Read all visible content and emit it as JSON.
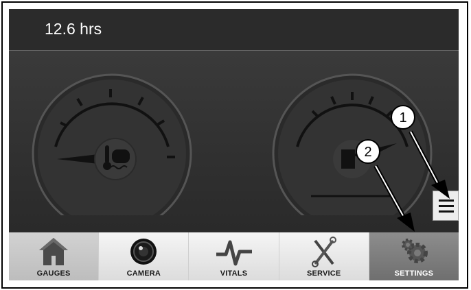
{
  "header": {
    "hours": "12.6 hrs"
  },
  "gauges": [
    {
      "name": "coolant-temperature-gauge",
      "icon": "coolant-temperature-icon"
    },
    {
      "name": "fuel-gauge",
      "icon": "fuel-pump-icon"
    }
  ],
  "menu_button": {
    "icon": "hamburger-menu-icon"
  },
  "callouts": [
    {
      "label": "1"
    },
    {
      "label": "2"
    }
  ],
  "nav": [
    {
      "label": "GAUGES",
      "icon": "home-icon",
      "state": "selected"
    },
    {
      "label": "CAMERA",
      "icon": "camera-icon",
      "state": "normal"
    },
    {
      "label": "VITALS",
      "icon": "pulse-icon",
      "state": "normal"
    },
    {
      "label": "SERVICE",
      "icon": "wrench-screwdriver-icon",
      "state": "normal"
    },
    {
      "label": "SETTINGS",
      "icon": "gears-icon",
      "state": "highlighted"
    }
  ],
  "colors": {
    "screen_bg": "#2f2f2f",
    "nav_bg": "#e6e6e6",
    "settings_bg": "#7a7a7a"
  }
}
